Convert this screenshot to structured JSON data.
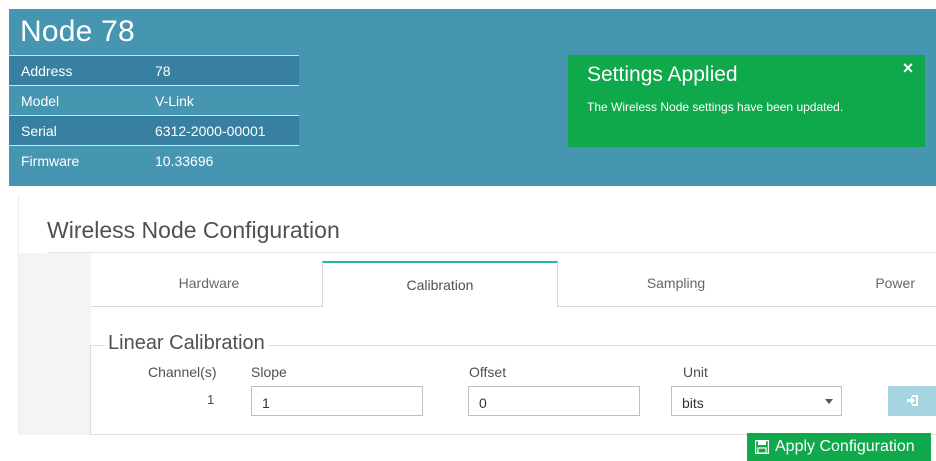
{
  "node": {
    "title": "Node 78",
    "info": [
      {
        "key": "Address",
        "value": "78"
      },
      {
        "key": "Model",
        "value": "V-Link"
      },
      {
        "key": "Serial",
        "value": "6312-2000-00001"
      },
      {
        "key": "Firmware",
        "value": "10.33696"
      }
    ]
  },
  "toast": {
    "title": "Settings Applied",
    "message": "The Wireless Node settings have been updated.",
    "close_glyph": "×"
  },
  "config": {
    "title": "Wireless Node Configuration",
    "tabs": [
      {
        "label": "Hardware",
        "active": false
      },
      {
        "label": "Calibration",
        "active": true
      },
      {
        "label": "Sampling",
        "active": false
      },
      {
        "label": "Power",
        "active": false
      }
    ]
  },
  "calibration": {
    "legend": "Linear Calibration",
    "channel_label": "Channel(s)",
    "slope_label": "Slope",
    "offset_label": "Offset",
    "unit_label": "Unit",
    "channel": "1",
    "slope": "1",
    "offset": "0",
    "unit": "bits"
  },
  "apply_button": {
    "label": "Apply Configuration",
    "icon": "save-icon"
  },
  "colors": {
    "header": "#4796b1",
    "success": "#0fa84a",
    "tab_accent": "#2bb5a1",
    "go_button": "#a7d4e1"
  }
}
